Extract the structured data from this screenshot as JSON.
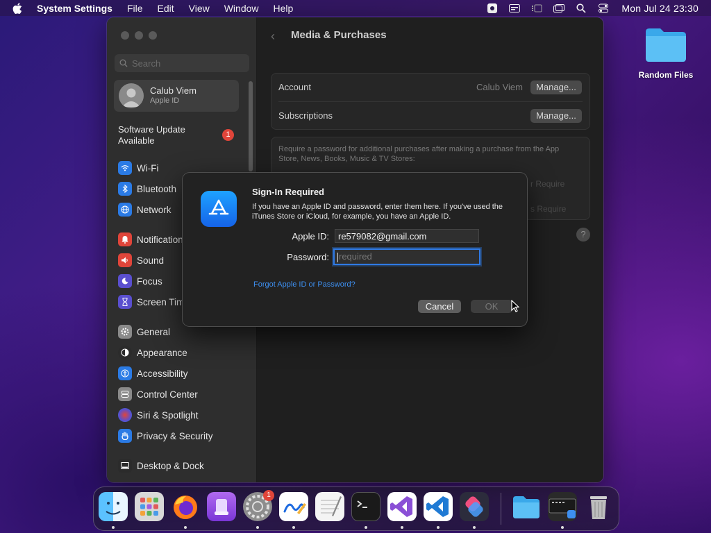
{
  "menubar": {
    "app_name": "System Settings",
    "menus": [
      "File",
      "Edit",
      "View",
      "Window",
      "Help"
    ],
    "clock": "Mon Jul 24  23:30"
  },
  "desktop": {
    "folder_label": "Random Files"
  },
  "sidebar": {
    "search_placeholder": "Search",
    "account": {
      "name": "Calub Viem",
      "subtitle": "Apple ID"
    },
    "update": {
      "label": "Software Update Available",
      "badge": "1"
    },
    "items": [
      {
        "label": "Wi-Fi",
        "icon": "wifi-icon",
        "color": "#2b7be5"
      },
      {
        "label": "Bluetooth",
        "icon": "bluetooth-icon",
        "color": "#2b7be5"
      },
      {
        "label": "Network",
        "icon": "globe-icon",
        "color": "#2b7be5"
      },
      {
        "label": "Notifications",
        "icon": "bell-icon",
        "color": "#e0453a"
      },
      {
        "label": "Sound",
        "icon": "speaker-icon",
        "color": "#e0453a"
      },
      {
        "label": "Focus",
        "icon": "moon-icon",
        "color": "#5a4fcf"
      },
      {
        "label": "Screen Time",
        "icon": "hourglass-icon",
        "color": "#5a4fcf"
      },
      {
        "label": "General",
        "icon": "gear-icon",
        "color": "#8a8a8a"
      },
      {
        "label": "Appearance",
        "icon": "appearance-icon",
        "color": "#2b2b2b"
      },
      {
        "label": "Accessibility",
        "icon": "accessibility-icon",
        "color": "#2b7be5"
      },
      {
        "label": "Control Center",
        "icon": "control-center-icon",
        "color": "#8a8a8a"
      },
      {
        "label": "Siri & Spotlight",
        "icon": "siri-icon",
        "color": "#c53a9a"
      },
      {
        "label": "Privacy & Security",
        "icon": "hand-icon",
        "color": "#2b7be5"
      },
      {
        "label": "Desktop & Dock",
        "icon": "dock-icon",
        "color": "#2b2b2b"
      }
    ]
  },
  "content": {
    "title": "Media & Purchases",
    "account_label": "Account",
    "account_value": "Calub Viem",
    "manage_label": "Manage...",
    "subscriptions_label": "Subscriptions",
    "require_text": "Require a password for additional purchases after making a purchase from the App Store, News, Books, Music & TV Stores:",
    "ghost1": "r Require",
    "ghost2": "s Require",
    "help": "?"
  },
  "dialog": {
    "title": "Sign-In Required",
    "message": "If you have an Apple ID and password, enter them here. If you've used the iTunes Store or iCloud, for example, you have an Apple ID.",
    "apple_id_label": "Apple ID:",
    "apple_id_value": "re579082@gmail.com",
    "password_label": "Password:",
    "password_placeholder": "required",
    "forgot_link": "Forgot Apple ID or Password?",
    "cancel": "Cancel",
    "ok": "OK"
  },
  "dock": {
    "settings_badge": "1",
    "apps": [
      "finder",
      "launchpad",
      "firefox",
      "podcasts",
      "system-settings",
      "freeform",
      "textedit",
      "terminal",
      "visual-studio",
      "vscode",
      "shortcuts",
      "downloads",
      "screen-sharing",
      "trash"
    ]
  }
}
